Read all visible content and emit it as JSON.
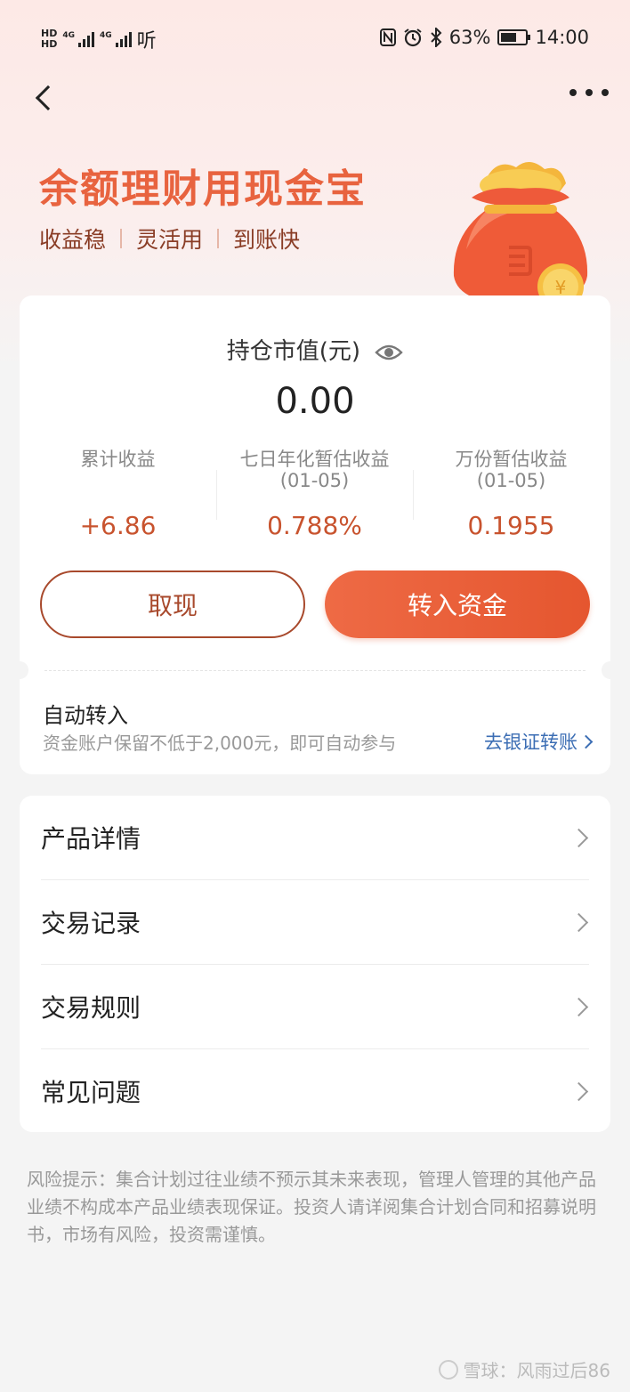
{
  "status_bar": {
    "hd1": "HD",
    "hd2": "HD",
    "network1": "4G",
    "network2": "4G",
    "audio_label": "听",
    "battery": "63%",
    "battery_level": 0.63,
    "time": "14:00"
  },
  "nav": {
    "back_icon": "chevron-left-icon",
    "more_icon": "more-dots-icon"
  },
  "hero": {
    "title": "余额理财用现金宝",
    "tags": [
      "收益稳",
      "灵活用",
      "到账快"
    ]
  },
  "holdings": {
    "label": "持仓市值(元)",
    "eye_icon": "eye-icon",
    "value": "0.00",
    "stats": [
      {
        "name": "累计收益",
        "date": "",
        "value": "+6.86"
      },
      {
        "name": "七日年化暂估收益",
        "date": "(01-05)",
        "value": "0.788%"
      },
      {
        "name": "万份暂估收益",
        "date": "(01-05)",
        "value": "0.1955"
      }
    ],
    "withdraw_label": "取现",
    "deposit_label": "转入资金"
  },
  "auto_transfer": {
    "title": "自动转入",
    "desc": "资金账户保留不低于2,000元，即可自动参与",
    "link": "去银证转账"
  },
  "menu": {
    "items": [
      {
        "label": "产品详情"
      },
      {
        "label": "交易记录"
      },
      {
        "label": "交易规则"
      },
      {
        "label": "常见问题"
      }
    ]
  },
  "risk_notice": "风险提示：集合计划过往业绩不预示其未来表现，管理人管理的其他产品业绩不构成本产品业绩表现保证。投资人请详阅集合计划合同和招募说明书，市场有风险，投资需谨慎。",
  "watermark": "雪球：风雨过后86",
  "colors": {
    "accent": "#e5562f",
    "title": "#e8633f",
    "value": "#c8532e",
    "link": "#3c6eb4"
  }
}
